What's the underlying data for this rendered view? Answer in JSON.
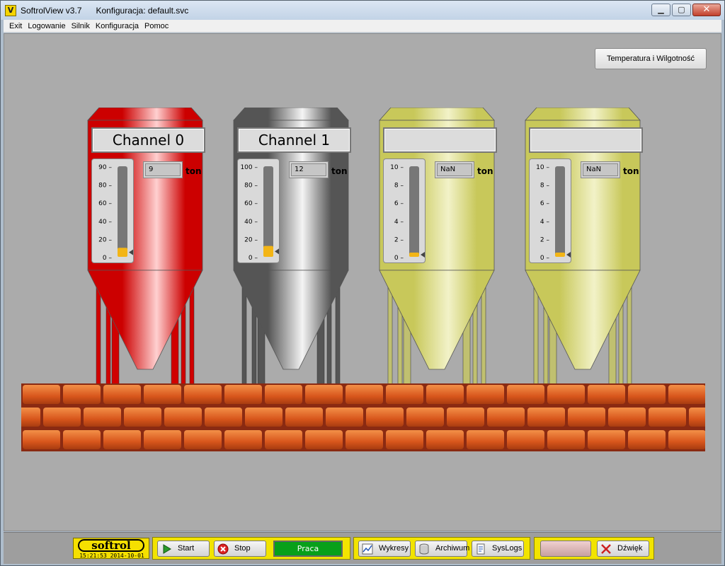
{
  "window": {
    "title": "SoftrolView v3.7      Konfiguracja: default.svc",
    "app_icon": "V"
  },
  "menu": [
    "Exit",
    "Logowanie",
    "Silnik",
    "Konfiguracja",
    "Pomoc"
  ],
  "temp_button": "Temperatura i Wilgotność",
  "silos": [
    {
      "name": "Channel 0",
      "value": "9",
      "unit": "ton",
      "ticks": [
        "90",
        "80",
        "60",
        "40",
        "20",
        "0"
      ],
      "level": 0.1,
      "colors": {
        "dark": "#cc0000",
        "light": "#ffd0d0",
        "leg": "#d00000"
      }
    },
    {
      "name": "Channel 1",
      "value": "12",
      "unit": "ton",
      "ticks": [
        "100",
        "80",
        "60",
        "40",
        "20",
        "0"
      ],
      "level": 0.12,
      "colors": {
        "dark": "#555555",
        "light": "#f4f4f4",
        "leg": "#555555"
      }
    },
    {
      "name": "",
      "value": "NaN",
      "unit": "ton",
      "ticks": [
        "10",
        "8",
        "6",
        "4",
        "2",
        "0"
      ],
      "level": 0.03,
      "colors": {
        "dark": "#c8c85a",
        "light": "#f2f2c8",
        "leg": "#c0c070"
      }
    },
    {
      "name": "",
      "value": "NaN",
      "unit": "ton",
      "ticks": [
        "10",
        "8",
        "6",
        "4",
        "2",
        "0"
      ],
      "level": 0.03,
      "colors": {
        "dark": "#c8c85a",
        "light": "#f2f2c8",
        "leg": "#c0c070"
      }
    }
  ],
  "footer": {
    "brand": "softrol",
    "timestamp": "15:21:53 2014-10-01",
    "start": "Start",
    "stop": "Stop",
    "status": "Praca",
    "wykresy": "Wykresy",
    "archiwum": "Archiwum",
    "syslogs": "SysLogs",
    "dzwiek": "Dźwięk"
  }
}
